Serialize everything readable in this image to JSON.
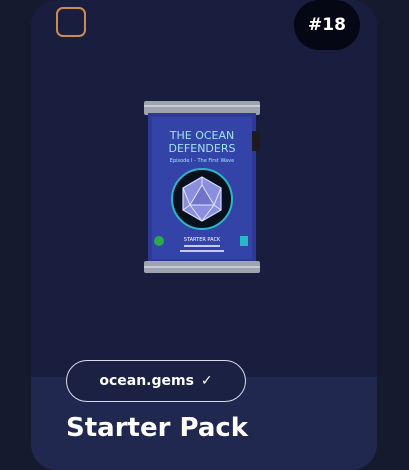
{
  "card": {
    "badge": "#18",
    "title": "Starter Pack",
    "creator": "ocean.gems",
    "verified_icon": "check-icon",
    "checkbox_checked": false
  },
  "pack": {
    "title_line1": "THE OCEAN",
    "title_line2": "DEFENDERS",
    "subtitle": "Episode I - The First Wave",
    "label": "STARTER PACK"
  },
  "colors": {
    "page_bg": "#161a2e",
    "card_bg": "#1b2143",
    "checkbox_border": "#c98c52",
    "badge_bg": "#050714"
  }
}
